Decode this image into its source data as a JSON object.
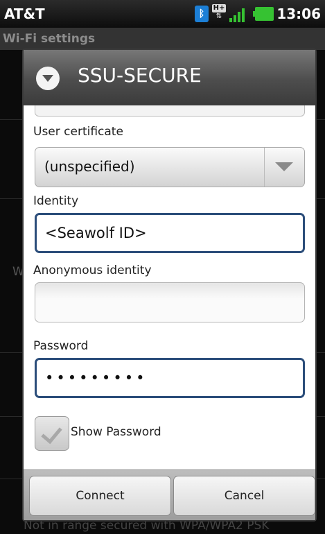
{
  "status_bar": {
    "carrier": "AT&T",
    "time": "13:06",
    "icons": [
      "bluetooth-icon",
      "hplus-data-icon",
      "signal-icon",
      "battery-icon"
    ],
    "accent": "#36c232"
  },
  "background": {
    "title": "Wi-Fi settings",
    "partial_letter": "W",
    "footer_text": "Not in range secured with WPA/WPA2 PSK"
  },
  "dialog": {
    "title": "SSU-SECURE",
    "icon": "wifi-lock-icon",
    "user_certificate": {
      "label": "User certificate",
      "value": "(unspecified)"
    },
    "identity": {
      "label": "Identity",
      "value": "<Seawolf ID>"
    },
    "anonymous_identity": {
      "label": "Anonymous identity",
      "value": ""
    },
    "password": {
      "label": "Password",
      "value": "•••••••••"
    },
    "show_password": {
      "label": "Show Password",
      "checked": true
    },
    "buttons": {
      "connect": "Connect",
      "cancel": "Cancel"
    },
    "focus_color": "#2b4d7a"
  }
}
